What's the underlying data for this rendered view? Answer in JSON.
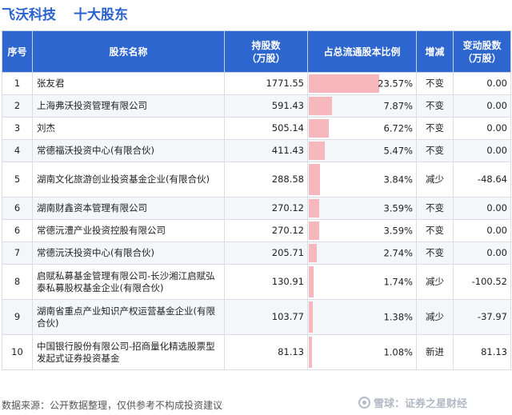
{
  "header": {
    "company": "飞沃科技",
    "title": "十大股东"
  },
  "columns": {
    "rank": "序号",
    "name": "股东名称",
    "shares_line1": "持股数",
    "shares_line2": "（万股）",
    "ratio": "占总流通股本比例",
    "change": "增减",
    "delta_line1": "变动股数",
    "delta_line2": "（万股）"
  },
  "rows": [
    {
      "rank": "1",
      "name": "张友君",
      "shares": "1771.55",
      "ratio_value": 23.57,
      "ratio": "23.57%",
      "change": "不变",
      "change_type": "same",
      "delta": "0.00"
    },
    {
      "rank": "2",
      "name": "上海弗沃投资管理有限公司",
      "shares": "591.43",
      "ratio_value": 7.87,
      "ratio": "7.87%",
      "change": "不变",
      "change_type": "same",
      "delta": "0.00"
    },
    {
      "rank": "3",
      "name": "刘杰",
      "shares": "505.14",
      "ratio_value": 6.72,
      "ratio": "6.72%",
      "change": "不变",
      "change_type": "same",
      "delta": "0.00"
    },
    {
      "rank": "4",
      "name": "常德福沃投资中心(有限合伙)",
      "shares": "411.43",
      "ratio_value": 5.47,
      "ratio": "5.47%",
      "change": "不变",
      "change_type": "same",
      "delta": "0.00"
    },
    {
      "rank": "5",
      "name": "湖南文化旅游创业投资基金企业(有限合伙)",
      "shares": "288.58",
      "ratio_value": 3.84,
      "ratio": "3.84%",
      "change": "减少",
      "change_type": "down",
      "delta": "-48.64"
    },
    {
      "rank": "6",
      "name": "湖南财鑫资本管理有限公司",
      "shares": "270.12",
      "ratio_value": 3.59,
      "ratio": "3.59%",
      "change": "不变",
      "change_type": "same",
      "delta": "0.00"
    },
    {
      "rank": "6",
      "name": "常德沅澧产业投资控股有限公司",
      "shares": "270.12",
      "ratio_value": 3.59,
      "ratio": "3.59%",
      "change": "不变",
      "change_type": "same",
      "delta": "0.00"
    },
    {
      "rank": "7",
      "name": "常德沅沃投资中心(有限合伙)",
      "shares": "205.71",
      "ratio_value": 2.74,
      "ratio": "2.74%",
      "change": "不变",
      "change_type": "same",
      "delta": "0.00"
    },
    {
      "rank": "8",
      "name": "启赋私募基金管理有限公司-长沙湘江启赋弘泰私募股权基金企业(有限合伙)",
      "shares": "130.91",
      "ratio_value": 1.74,
      "ratio": "1.74%",
      "change": "减少",
      "change_type": "down",
      "delta": "-100.52"
    },
    {
      "rank": "9",
      "name": "湖南省重点产业知识产权运营基金企业(有限合伙)",
      "shares": "103.77",
      "ratio_value": 1.38,
      "ratio": "1.38%",
      "change": "减少",
      "change_type": "down",
      "delta": "-37.97"
    },
    {
      "rank": "10",
      "name": "中国银行股份有限公司-招商量化精选股票型发起式证券投资基金",
      "shares": "81.13",
      "ratio_value": 1.08,
      "ratio": "1.08%",
      "change": "新进",
      "change_type": "new",
      "delta": "81.13"
    }
  ],
  "footer": {
    "source": "数据来源：公开数据整理，仅供参考不构成投资建议"
  },
  "watermark": {
    "text": "雪球：证券之星财经",
    "icon": "snowball-icon"
  },
  "colors": {
    "header_bg": "#2e66cf",
    "title": "#2a62cf",
    "bar": "#f7b8bd",
    "down": "#2e9b2e",
    "new": "#e02020"
  }
}
